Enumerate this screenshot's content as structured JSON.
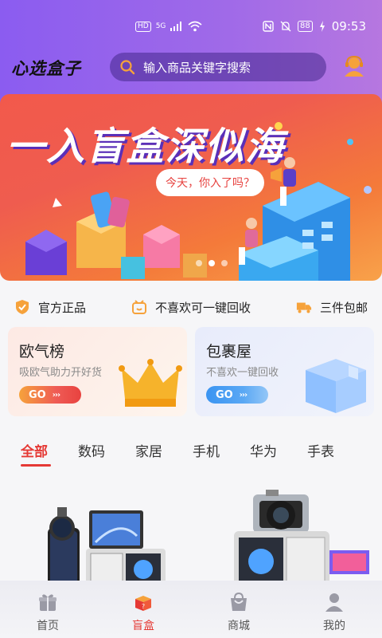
{
  "status_bar": {
    "hd": "HD",
    "network": "5G",
    "battery": "88",
    "time": "09:53"
  },
  "header": {
    "logo": "心选盒子",
    "search_placeholder": "输入商品关键字搜索"
  },
  "banner": {
    "title": "一入盲盒深似海",
    "bubble": "今天，你入了吗？"
  },
  "features": [
    {
      "label": "官方正品",
      "icon": "official-badge-icon"
    },
    {
      "label": "不喜欢可一键回收",
      "icon": "recycle-icon"
    },
    {
      "label": "三件包邮",
      "icon": "delivery-truck-icon"
    }
  ],
  "cards": {
    "left": {
      "title": "欧气榜",
      "subtitle": "吸欧气助力开好货",
      "button": "GO",
      "arrows": "›››"
    },
    "right": {
      "title": "包裹屋",
      "subtitle": "不喜欢一键回收",
      "button": "GO",
      "arrows": "›››"
    }
  },
  "tabs": [
    "全部",
    "数码",
    "家居",
    "手机",
    "华为",
    "手表"
  ],
  "active_tab": "全部",
  "bottom_nav": [
    {
      "label": "首页",
      "icon": "gift-icon"
    },
    {
      "label": "盲盒",
      "icon": "blind-box-icon"
    },
    {
      "label": "商城",
      "icon": "shopping-bag-icon"
    },
    {
      "label": "我的",
      "icon": "profile-icon"
    }
  ],
  "colors": {
    "accent": "#e53935",
    "header_purple": "#8b5cf0",
    "banner_red": "#ef5c4f"
  }
}
